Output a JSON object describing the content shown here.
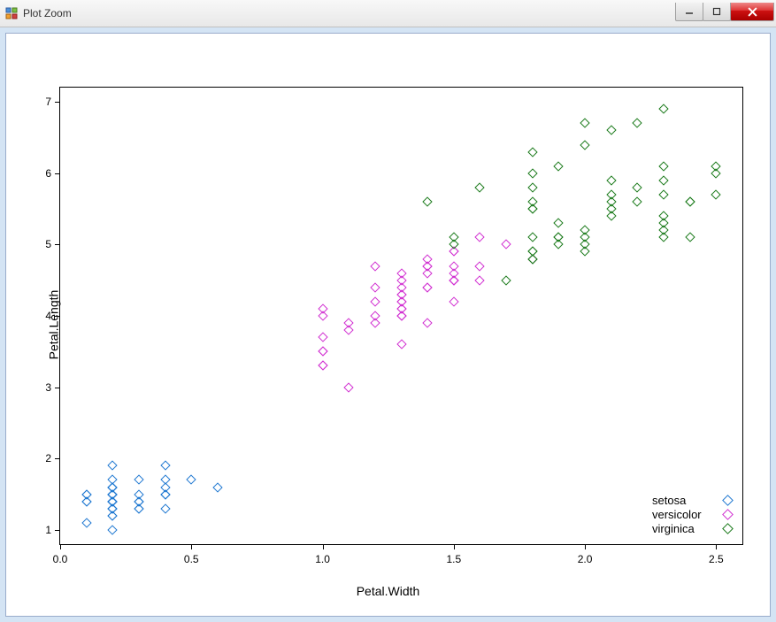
{
  "window": {
    "title": "Plot Zoom"
  },
  "chart_data": {
    "type": "scatter",
    "xlabel": "Petal.Width",
    "ylabel": "Petal.Length",
    "xlim": [
      0.0,
      2.6
    ],
    "ylim": [
      0.8,
      7.2
    ],
    "xticks": [
      0.0,
      0.5,
      1.0,
      1.5,
      2.0,
      2.5
    ],
    "yticks": [
      1,
      2,
      3,
      4,
      5,
      6,
      7
    ],
    "legend_position": "bottom-right",
    "colors": {
      "setosa": "#1f78d1",
      "versicolor": "#d130d1",
      "virginica": "#1a7a1a"
    },
    "series": [
      {
        "name": "setosa",
        "x": [
          0.2,
          0.2,
          0.2,
          0.2,
          0.2,
          0.4,
          0.3,
          0.2,
          0.2,
          0.1,
          0.2,
          0.2,
          0.1,
          0.1,
          0.2,
          0.4,
          0.4,
          0.3,
          0.3,
          0.3,
          0.2,
          0.4,
          0.2,
          0.5,
          0.2,
          0.2,
          0.4,
          0.2,
          0.2,
          0.2,
          0.2,
          0.4,
          0.1,
          0.2,
          0.2,
          0.2,
          0.2,
          0.1,
          0.2,
          0.2,
          0.3,
          0.3,
          0.2,
          0.6,
          0.4,
          0.3,
          0.2,
          0.2,
          0.2,
          0.2
        ],
        "y": [
          1.4,
          1.4,
          1.3,
          1.5,
          1.4,
          1.7,
          1.4,
          1.5,
          1.4,
          1.5,
          1.5,
          1.6,
          1.4,
          1.1,
          1.2,
          1.5,
          1.3,
          1.4,
          1.7,
          1.5,
          1.7,
          1.5,
          1.0,
          1.7,
          1.9,
          1.6,
          1.6,
          1.5,
          1.4,
          1.6,
          1.6,
          1.5,
          1.5,
          1.4,
          1.5,
          1.2,
          1.3,
          1.4,
          1.3,
          1.5,
          1.3,
          1.3,
          1.3,
          1.6,
          1.9,
          1.4,
          1.6,
          1.4,
          1.5,
          1.4
        ]
      },
      {
        "name": "versicolor",
        "x": [
          1.4,
          1.5,
          1.5,
          1.3,
          1.5,
          1.3,
          1.6,
          1.0,
          1.3,
          1.4,
          1.0,
          1.5,
          1.0,
          1.4,
          1.3,
          1.4,
          1.5,
          1.0,
          1.5,
          1.1,
          1.8,
          1.3,
          1.5,
          1.2,
          1.3,
          1.4,
          1.4,
          1.7,
          1.5,
          1.0,
          1.1,
          1.0,
          1.2,
          1.6,
          1.5,
          1.6,
          1.5,
          1.3,
          1.3,
          1.3,
          1.2,
          1.4,
          1.2,
          1.0,
          1.3,
          1.2,
          1.3,
          1.3,
          1.1,
          1.3
        ],
        "y": [
          4.7,
          4.5,
          4.9,
          4.0,
          4.6,
          4.5,
          4.7,
          3.3,
          4.6,
          3.9,
          3.5,
          4.2,
          4.0,
          4.7,
          3.6,
          4.4,
          4.5,
          4.1,
          4.5,
          3.9,
          4.8,
          4.0,
          4.9,
          4.7,
          4.3,
          4.4,
          4.8,
          5.0,
          4.5,
          3.5,
          3.8,
          3.7,
          3.9,
          5.1,
          4.5,
          4.5,
          4.7,
          4.4,
          4.1,
          4.0,
          4.4,
          4.6,
          4.0,
          3.3,
          4.2,
          4.2,
          4.2,
          4.3,
          3.0,
          4.1
        ]
      },
      {
        "name": "virginica",
        "x": [
          2.5,
          1.9,
          2.1,
          1.8,
          2.2,
          2.1,
          1.7,
          1.8,
          1.8,
          2.5,
          2.0,
          1.9,
          2.1,
          2.0,
          2.4,
          2.3,
          1.8,
          2.2,
          2.3,
          1.5,
          2.3,
          2.0,
          2.0,
          1.8,
          2.1,
          1.8,
          1.8,
          1.8,
          2.1,
          1.6,
          1.9,
          2.0,
          2.2,
          1.5,
          1.4,
          2.3,
          2.4,
          1.8,
          1.8,
          2.1,
          2.4,
          2.3,
          1.9,
          2.3,
          2.5,
          2.3,
          1.9,
          2.0,
          2.3,
          1.8
        ],
        "y": [
          6.0,
          5.1,
          5.9,
          5.6,
          5.8,
          6.6,
          4.5,
          6.3,
          5.8,
          6.1,
          5.1,
          5.3,
          5.5,
          5.0,
          5.1,
          5.3,
          5.5,
          6.7,
          6.9,
          5.0,
          5.7,
          4.9,
          6.7,
          4.9,
          5.7,
          6.0,
          4.8,
          4.9,
          5.6,
          5.8,
          6.1,
          6.4,
          5.6,
          5.1,
          5.6,
          6.1,
          5.6,
          5.5,
          4.8,
          5.4,
          5.6,
          5.1,
          5.1,
          5.9,
          5.7,
          5.2,
          5.0,
          5.2,
          5.4,
          5.1
        ]
      }
    ]
  }
}
